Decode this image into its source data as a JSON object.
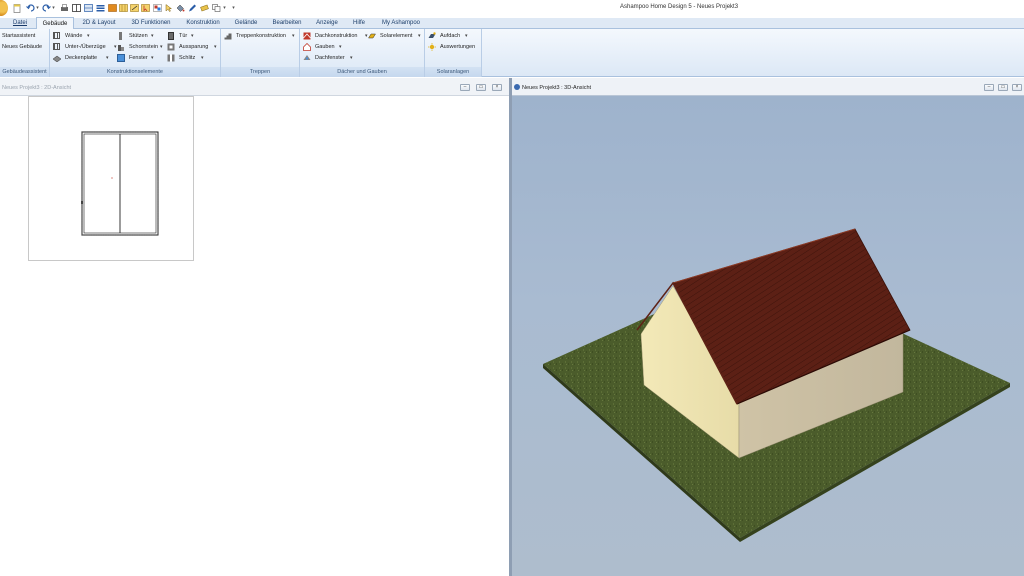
{
  "window": {
    "title": "Ashampoo Home Design 5 - Neues Projekt3"
  },
  "quick_access": {
    "icons": [
      "new-file-icon",
      "undo-icon",
      "redo-icon",
      "print-icon",
      "grid-icon",
      "wall-tool-icon",
      "paint-icon",
      "select-icon",
      "copy-icon"
    ],
    "more": "▾"
  },
  "tabs": [
    {
      "label": "Datei"
    },
    {
      "label": "Gebäude"
    },
    {
      "label": "2D & Layout"
    },
    {
      "label": "3D Funktionen"
    },
    {
      "label": "Konstruktion"
    },
    {
      "label": "Gelände"
    },
    {
      "label": "Bearbeiten"
    },
    {
      "label": "Anzeige"
    },
    {
      "label": "Hilfe"
    },
    {
      "label": "My Ashampoo"
    }
  ],
  "ribbon": {
    "gebaeudeassistent": {
      "startassistent": "Startassistent",
      "neues_gebaeude": "Neues Gebäude",
      "label": "Gebäudeassistent"
    },
    "konstruktion": {
      "waende": "Wände",
      "unter_ueberzuege": "Unter-/Überzüge",
      "deckenplatte": "Deckenplatte",
      "stuetzen": "Stützen",
      "schornstein": "Schornstein",
      "fenster": "Fenster",
      "tuer": "Tür",
      "aussparung": "Aussparung",
      "schlitz": "Schlitz",
      "label": "Konstruktionselemente"
    },
    "treppen": {
      "treppenkonstruktion": "Treppenkonstruktion",
      "label": "Treppen"
    },
    "daecher": {
      "dachkonstruktion": "Dachkonstruktion",
      "gauben": "Gauben",
      "dachfenster": "Dachfenster",
      "solarelement": "Solarelement",
      "label": "Dächer und Gauben"
    },
    "solar": {
      "aufdach": "Aufdach",
      "auswertungen": "Auswertungen",
      "label": "Solaranlagen"
    },
    "dropdown_glyph": "▾"
  },
  "views": {
    "plan": {
      "title": "Neues Projekt3 : 2D-Ansicht"
    },
    "three_d": {
      "title": "Neues Projekt3 : 3D-Ansicht"
    }
  },
  "window_buttons": {
    "minimize": "–",
    "restore": "▭",
    "close": "×"
  },
  "colors": {
    "ribbon_accent": "#dfe9f5",
    "roof": "#5e2216",
    "wall_front": "#f0e6b4",
    "wall_side": "#c9bfa6",
    "lawn": "#4a5a2c",
    "sky_top": "#9db2cc"
  }
}
